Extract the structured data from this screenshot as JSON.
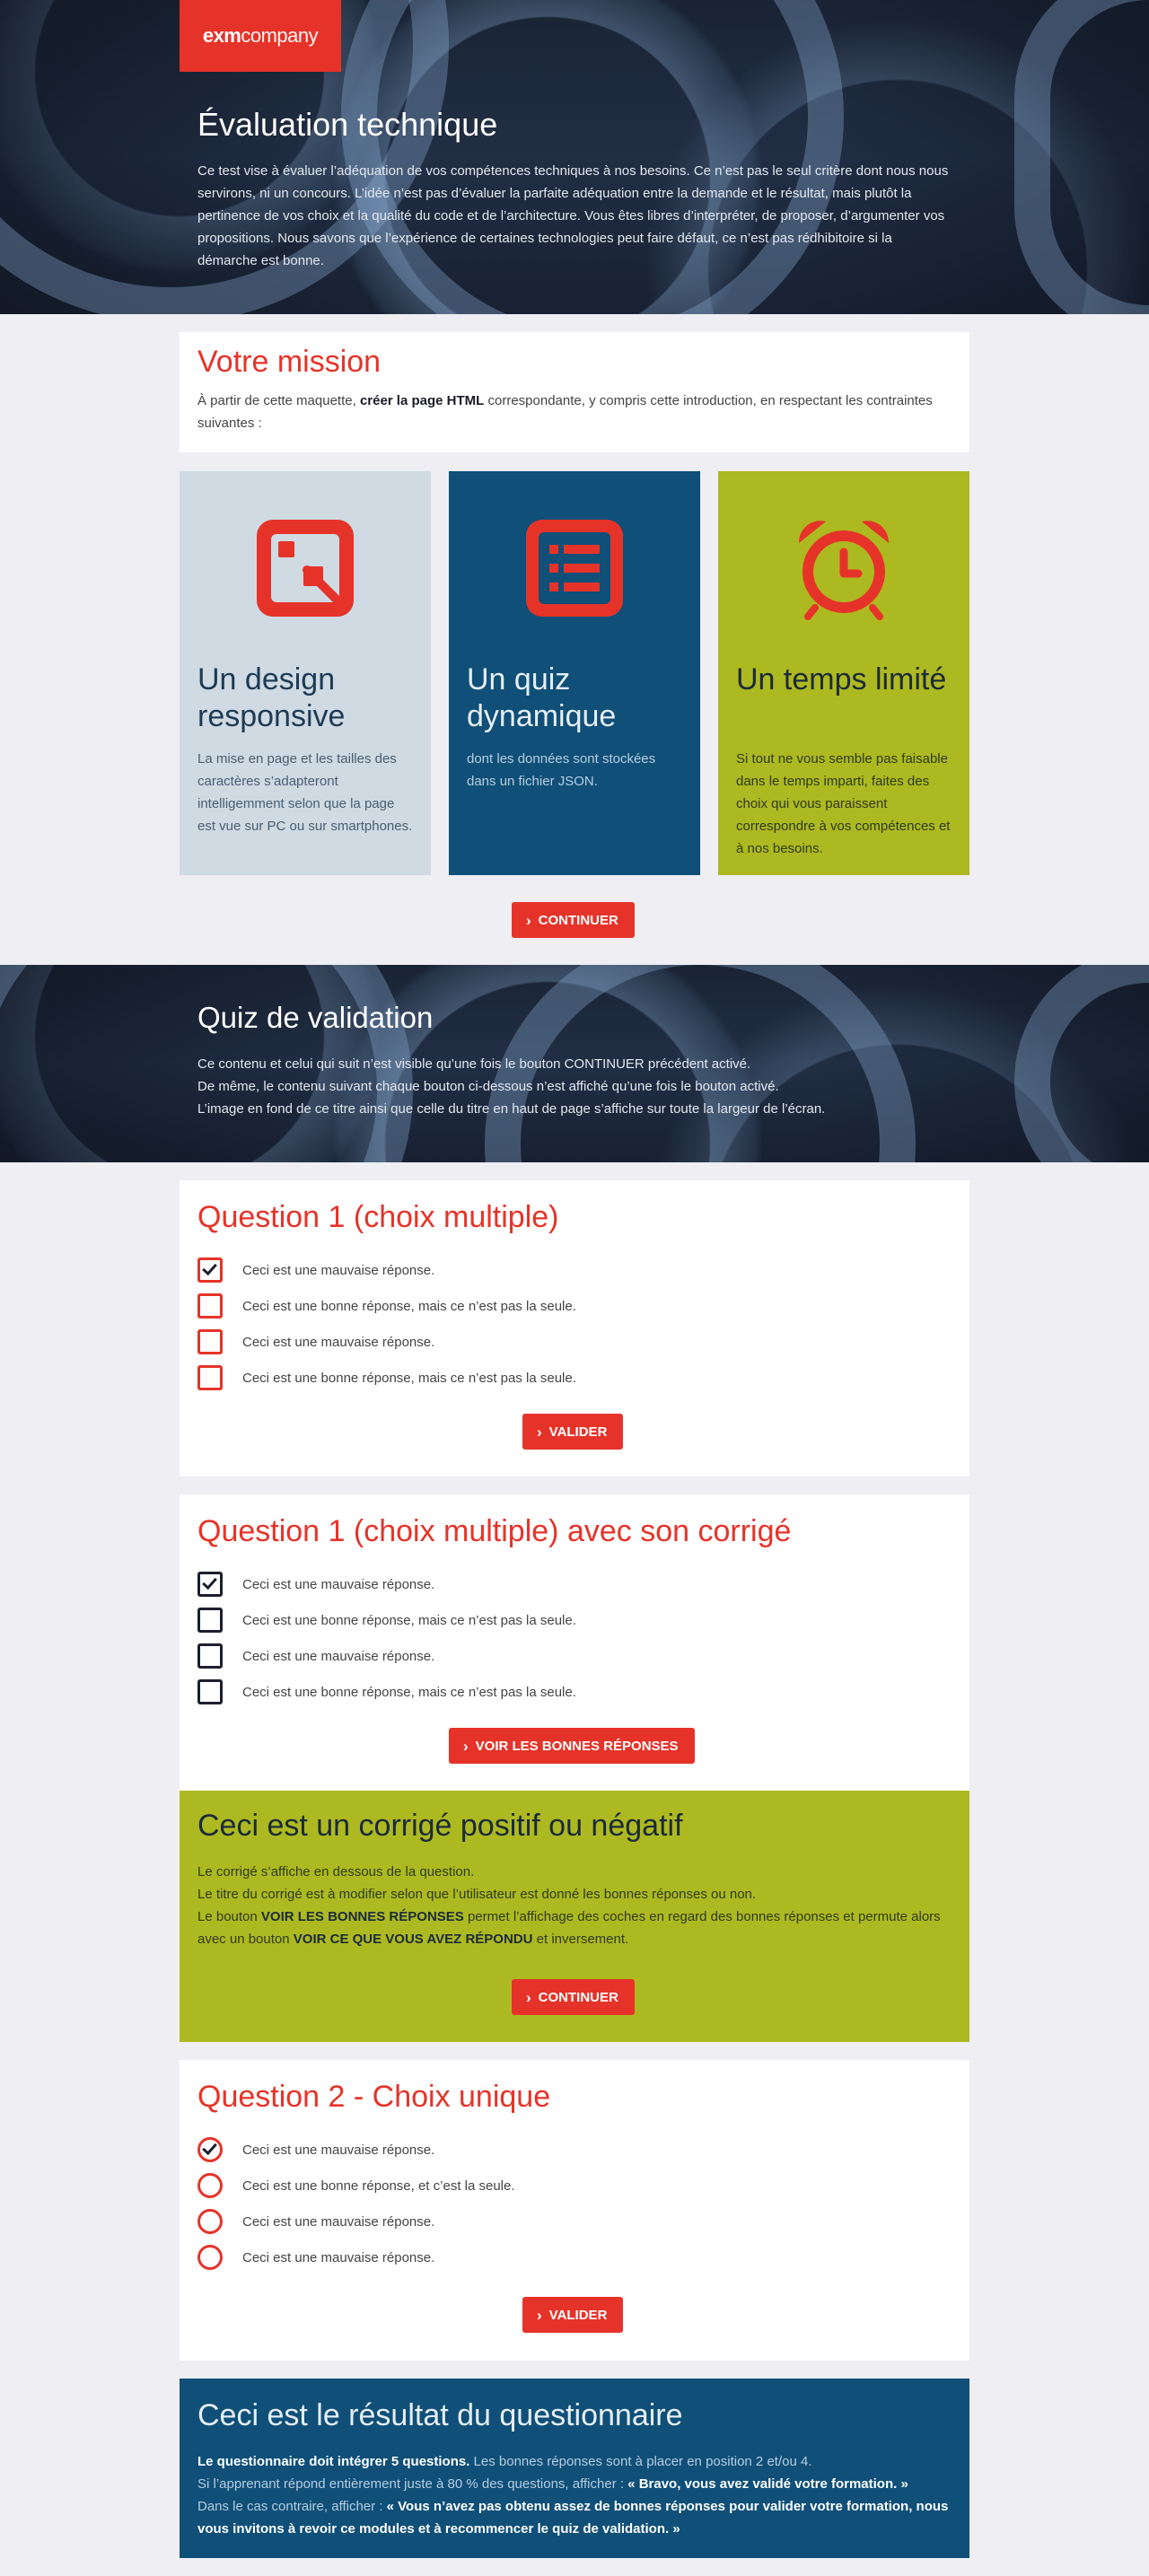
{
  "logo": {
    "bold": "exm",
    "light": "company"
  },
  "hero": {
    "title": "Évaluation technique",
    "text": "Ce test vise à évaluer l’adéquation de vos compétences techniques à nos besoins. Ce n’est pas le seul critère dont nous nous servirons, ni un concours. L’idée n’est pas d’évaluer la parfaite adéquation entre la demande et le résultat, mais plutôt la pertinence de vos choix et la qualité du code et de l’architecture. Vous êtes libres d’interpréter, de proposer, d’argumenter vos propositions. Nous savons que l’expérience de certaines technologies peut faire défaut, ce n’est pas rédhibitoire si la démarche est bonne."
  },
  "mission": {
    "title": "Votre mission",
    "text_before": "À partir de cette maquette, ",
    "text_bold": "créer la page HTML",
    "text_after": " correspondante, y compris cette introduction, en respectant les contraintes suivantes :"
  },
  "features": [
    {
      "title": "Un design responsive",
      "text": "La mise en page et les tailles des caractères s’adapteront intelligemment selon que la page est vue sur PC ou sur smartphones.",
      "icon": "responsive-icon"
    },
    {
      "title": "Un quiz dynamique",
      "text": "dont les données sont stockées dans un fichier JSON.",
      "icon": "list-icon"
    },
    {
      "title": "Un temps limité",
      "text": "Si tout ne vous semble pas faisable dans le temps imparti, faites des choix qui vous paraissent correspondre à vos compétences et à nos besoins.",
      "icon": "alarm-clock-icon"
    }
  ],
  "continue_label": "CONTINUER",
  "quiz_hero": {
    "title": "Quiz de validation",
    "line1": "Ce contenu et celui qui suit n’est visible qu’une fois le bouton CONTINUER précédent activé.",
    "line2": "De même, le contenu suivant chaque bouton ci-dessous n’est affiché qu’une fois le bouton activé.",
    "line3": "L’image en fond de ce titre ainsi que celle du titre en haut de page s’affiche sur toute la largeur de l’écran."
  },
  "q1": {
    "title": "Question 1 (choix multiple)",
    "options": [
      {
        "label": "Ceci est une mauvaise réponse.",
        "checked": true
      },
      {
        "label": "Ceci est une bonne réponse, mais ce n’est pas la seule.",
        "checked": false
      },
      {
        "label": "Ceci est une mauvaise réponse.",
        "checked": false
      },
      {
        "label": "Ceci est une bonne réponse, mais ce n’est pas la seule.",
        "checked": false
      }
    ],
    "button": "VALIDER"
  },
  "q1_corr": {
    "title": "Question 1 (choix multiple) avec son corrigé",
    "options": [
      {
        "label": "Ceci est une mauvaise réponse.",
        "checked": true
      },
      {
        "label": "Ceci est une bonne réponse, mais ce n’est pas la seule.",
        "checked": false
      },
      {
        "label": "Ceci est une mauvaise réponse.",
        "checked": false
      },
      {
        "label": "Ceci est une bonne réponse, mais ce n’est pas la seule.",
        "checked": false
      }
    ],
    "button": "VOIR LES BONNES RÉPONSES"
  },
  "correction": {
    "title": "Ceci est un corrigé positif ou négatif",
    "line1": "Le corrigé s’affiche en dessous de la question.",
    "line2": "Le titre du corrigé est à modifier selon que l’utilisateur est donné les bonnes réponses ou non.",
    "line3_a": "Le bouton ",
    "line3_b": "VOIR LES BONNES RÉPONSES",
    "line3_c": " permet l’affichage des coches en regard des bonnes réponses et permute alors avec un bouton ",
    "line3_d": "VOIR CE QUE VOUS AVEZ RÉPONDU",
    "line3_e": " et inversement.",
    "button": "CONTINUER"
  },
  "q2": {
    "title": "Question 2 - Choix unique",
    "options": [
      {
        "label": "Ceci est une mauvaise réponse.",
        "checked": true
      },
      {
        "label": "Ceci est une bonne réponse, et c’est la seule.",
        "checked": false
      },
      {
        "label": "Ceci est une mauvaise réponse.",
        "checked": false
      },
      {
        "label": "Ceci est une mauvaise réponse.",
        "checked": false
      }
    ],
    "button": "VALIDER"
  },
  "result": {
    "title": "Ceci est le résultat du questionnaire",
    "l1_bold": "Le questionnaire doit intégrer 5 questions.",
    "l1_rest": " Les bonnes réponses sont à placer en position 2 et/ou 4.",
    "l2_a": "Si l’apprenant répond entièrement juste à 80 % des questions, afficher : ",
    "l2_b": "« Bravo, vous avez validé votre formation. »",
    "l3_a": "Dans le cas contraire, afficher : ",
    "l3_b": "« Vous n’avez pas obtenu assez de bonnes réponses pour valider votre formation, nous vous invitons à revoir ce modules et à recommencer le quiz de validation. »"
  },
  "colors": {
    "accent": "#e63329",
    "blue": "#0f4f78",
    "olive": "#adb920",
    "grey_blue": "#cfdae2"
  }
}
